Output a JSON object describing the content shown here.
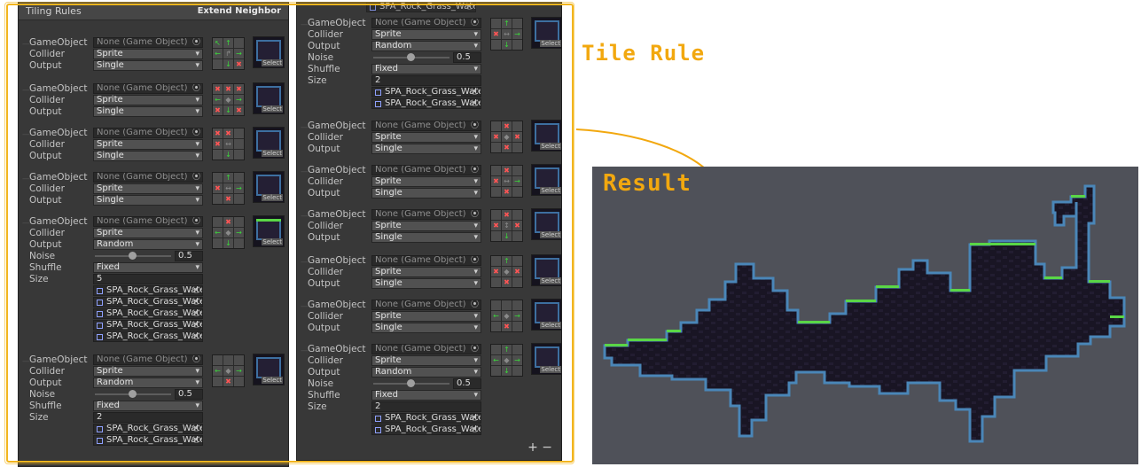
{
  "left_panel": {
    "header_title": "Tiling Rules",
    "extend_label": "Extend Neighbor",
    "rules": [
      {
        "gameobject": "None (Game Object)",
        "collider": "Sprite",
        "output": "Single"
      },
      {
        "gameobject": "None (Game Object)",
        "collider": "Sprite",
        "output": "Single"
      },
      {
        "gameobject": "None (Game Object)",
        "collider": "Sprite",
        "output": "Single"
      },
      {
        "gameobject": "None (Game Object)",
        "collider": "Sprite",
        "output": "Single"
      },
      {
        "gameobject": "None (Game Object)",
        "collider": "Sprite",
        "output": "Random",
        "noise": "0.5",
        "shuffle": "Fixed",
        "size": "5",
        "sprites": [
          "SPA_Rock_Grass_Wate",
          "SPA_Rock_Grass_Wate",
          "SPA_Rock_Grass_Wate",
          "SPA_Rock_Grass_Wate",
          "SPA_Rock_Grass_Wate"
        ]
      },
      {
        "gameobject": "None (Game Object)",
        "collider": "Sprite",
        "output": "Random",
        "noise": "0.5",
        "shuffle": "Fixed",
        "size": "2",
        "sprites": [
          "SPA_Rock_Grass_Wate",
          "SPA_Rock_Grass_Wate"
        ]
      }
    ]
  },
  "right_panel": {
    "top_sprite": "SPA_Rock_Grass_Wate",
    "rules": [
      {
        "gameobject": "None (Game Object)",
        "collider": "Sprite",
        "output": "Random",
        "noise": "0.5",
        "shuffle": "Fixed",
        "size": "2",
        "sprites": [
          "SPA_Rock_Grass_Wate",
          "SPA_Rock_Grass_Wate"
        ]
      },
      {
        "gameobject": "None (Game Object)",
        "collider": "Sprite",
        "output": "Single"
      },
      {
        "gameobject": "None (Game Object)",
        "collider": "Sprite",
        "output": "Single"
      },
      {
        "gameobject": "None (Game Object)",
        "collider": "Sprite",
        "output": "Single"
      },
      {
        "gameobject": "None (Game Object)",
        "collider": "Sprite",
        "output": "Single"
      },
      {
        "gameobject": "None (Game Object)",
        "collider": "Sprite",
        "output": "Single"
      },
      {
        "gameobject": "None (Game Object)",
        "collider": "Sprite",
        "output": "Random",
        "noise": "0.5",
        "shuffle": "Fixed",
        "size": "2",
        "sprites": [
          "SPA_Rock_Grass_Wate",
          "SPA_Rock_Grass_Wate"
        ]
      }
    ],
    "add_remove": "+  −"
  },
  "labels": {
    "gameobject": "GameObject",
    "collider": "Collider",
    "output": "Output",
    "noise": "Noise",
    "shuffle": "Shuffle",
    "size": "Size",
    "select": "Select"
  },
  "annotations": {
    "tile_rule": "Tile Rule",
    "result": "Result"
  },
  "colors": {
    "accent": "#f2b51e",
    "panel": "#383838",
    "arrow_green": "#3bd63b",
    "cross_red": "#ff5555",
    "result_bg": "#4f5159"
  }
}
